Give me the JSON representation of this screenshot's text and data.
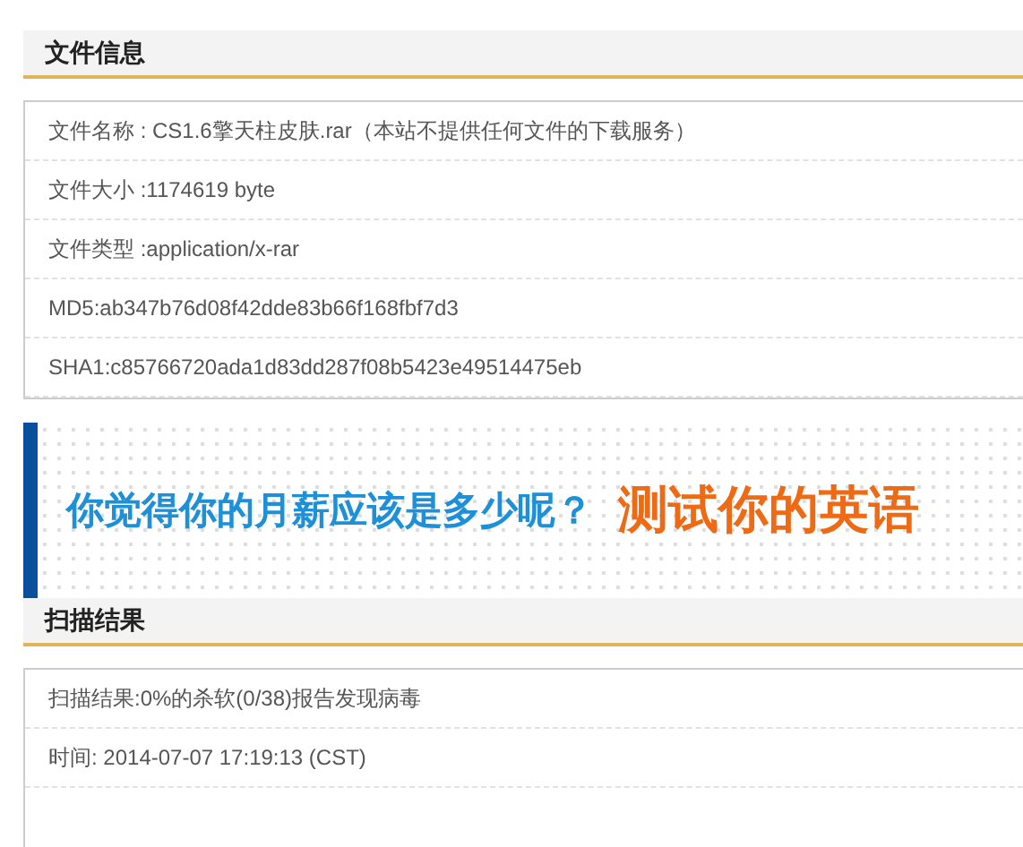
{
  "file_info": {
    "title": "文件信息",
    "rows": [
      "文件名称 : CS1.6擎天柱皮肤.rar（本站不提供任何文件的下载服务）",
      "文件大小 :1174619 byte",
      "文件类型 :application/x-rar",
      "MD5:ab347b76d08f42dde83b66f168fbf7d3",
      "SHA1:c85766720ada1d83dd287f08b5423e49514475eb"
    ]
  },
  "banner": {
    "question": "你觉得你的月薪应该是多少呢？",
    "cta": "测试你的英语"
  },
  "scan_result": {
    "title": "扫描结果",
    "rows": [
      "扫描结果:0%的杀软(0/38)报告发现病毒",
      "时间: 2014-07-07 17:19:13 (CST)"
    ]
  }
}
